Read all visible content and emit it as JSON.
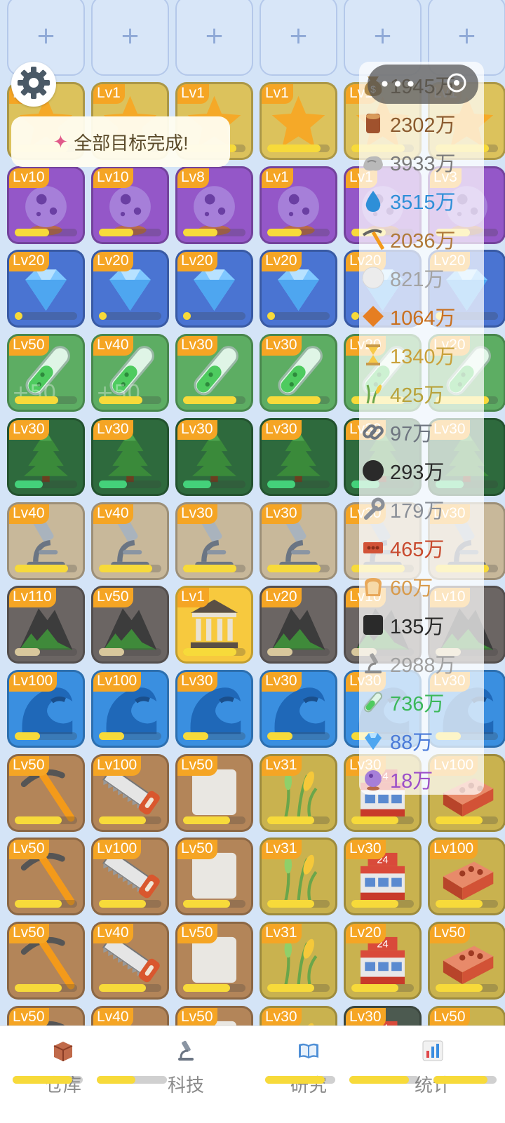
{
  "top_slots": {
    "symbol": "+",
    "count": 6
  },
  "settings": {
    "icon": "gear-icon"
  },
  "toast": {
    "icon": "party-popper-icon",
    "text": "全部目标完成!"
  },
  "capsule": {
    "menu_icon": "more-dots-icon",
    "close_icon": "close-circle-icon"
  },
  "colors": {
    "yellow": "#dcc25c",
    "purple": "#9457c8",
    "blue": "#4a74d2",
    "green": "#5dad63",
    "darkgreen": "#2e6a3d",
    "beige": "#c8b89a",
    "gray": "#6b6563",
    "sea": "#3a8fe0",
    "brown": "#b38559",
    "olive": "#c9b24f",
    "gold": "#f7c93e",
    "slate": "#4c5a50",
    "level_badge": "#f5a524",
    "progress": "#f7da3a"
  },
  "grid": {
    "rows": [
      [
        {
          "lv": "Lv1",
          "icon": "star-icon",
          "color": "yellow",
          "progress": 0.85
        },
        {
          "lv": "Lv1",
          "icon": "star-icon",
          "color": "yellow",
          "progress": 0.85
        },
        {
          "lv": "Lv1",
          "icon": "star-icon",
          "color": "yellow",
          "progress": 0.85
        },
        {
          "lv": "Lv1",
          "icon": "star-icon",
          "color": "yellow",
          "progress": 0.85
        },
        {
          "lv": "Lv1",
          "icon": "star-icon",
          "color": "yellow",
          "progress": 0.85
        },
        {
          "lv": "Lv1",
          "icon": "star-icon",
          "color": "yellow",
          "progress": 0.85
        }
      ],
      [
        {
          "lv": "Lv10",
          "icon": "crystal-ball-icon",
          "color": "purple",
          "progress": 0.55
        },
        {
          "lv": "Lv10",
          "icon": "crystal-ball-icon",
          "color": "purple",
          "progress": 0.55
        },
        {
          "lv": "Lv8",
          "icon": "crystal-ball-icon",
          "color": "purple",
          "progress": 0.55
        },
        {
          "lv": "Lv1",
          "icon": "crystal-ball-icon",
          "color": "purple",
          "progress": 0.55
        },
        {
          "lv": "Lv1",
          "icon": "crystal-ball-icon",
          "color": "purple",
          "progress": 0.55
        },
        {
          "lv": "Lv3",
          "icon": "crystal-ball-icon",
          "color": "purple",
          "progress": 0.55
        }
      ],
      [
        {
          "lv": "Lv20",
          "icon": "diamond-icon",
          "color": "blue",
          "progress": 0.05
        },
        {
          "lv": "Lv20",
          "icon": "diamond-icon",
          "color": "blue",
          "progress": 0.05
        },
        {
          "lv": "Lv20",
          "icon": "diamond-icon",
          "color": "blue",
          "progress": 0.05
        },
        {
          "lv": "Lv20",
          "icon": "diamond-icon",
          "color": "blue",
          "progress": 0.05
        },
        {
          "lv": "Lv20",
          "icon": "diamond-icon",
          "color": "blue",
          "progress": 0.05
        },
        {
          "lv": "Lv20",
          "icon": "diamond-icon",
          "color": "blue",
          "progress": 0.05
        }
      ],
      [
        {
          "lv": "Lv50",
          "icon": "test-tube-icon",
          "color": "green",
          "progress": 0.7,
          "ghost": "+50"
        },
        {
          "lv": "Lv40",
          "icon": "test-tube-icon",
          "color": "green",
          "progress": 0.7,
          "ghost": "+50"
        },
        {
          "lv": "Lv30",
          "icon": "test-tube-icon",
          "color": "green",
          "progress": 0.85
        },
        {
          "lv": "Lv30",
          "icon": "test-tube-icon",
          "color": "green",
          "progress": 0.85
        },
        {
          "lv": "Lv20",
          "icon": "test-tube-icon",
          "color": "green",
          "progress": 0.85
        },
        {
          "lv": "Lv20",
          "icon": "test-tube-icon",
          "color": "green",
          "progress": 0.85
        }
      ],
      [
        {
          "lv": "Lv30",
          "icon": "pine-tree-icon",
          "color": "darkgreen",
          "progress": 0.45,
          "bar": "green"
        },
        {
          "lv": "Lv30",
          "icon": "pine-tree-icon",
          "color": "darkgreen",
          "progress": 0.45,
          "bar": "green"
        },
        {
          "lv": "Lv30",
          "icon": "pine-tree-icon",
          "color": "darkgreen",
          "progress": 0.45,
          "bar": "green"
        },
        {
          "lv": "Lv30",
          "icon": "pine-tree-icon",
          "color": "darkgreen",
          "progress": 0.45,
          "bar": "green"
        },
        {
          "lv": "Lv30",
          "icon": "pine-tree-icon",
          "color": "darkgreen",
          "progress": 0.45,
          "bar": "green"
        },
        {
          "lv": "Lv30",
          "icon": "pine-tree-icon",
          "color": "darkgreen",
          "progress": 0.45,
          "bar": "green"
        }
      ],
      [
        {
          "lv": "Lv40",
          "icon": "microscope-icon",
          "color": "beige",
          "progress": 0.85
        },
        {
          "lv": "Lv40",
          "icon": "microscope-icon",
          "color": "beige",
          "progress": 0.85
        },
        {
          "lv": "Lv30",
          "icon": "microscope-icon",
          "color": "beige",
          "progress": 0.85
        },
        {
          "lv": "Lv30",
          "icon": "microscope-icon",
          "color": "beige",
          "progress": 0.85
        },
        {
          "lv": "Lv30",
          "icon": "microscope-icon",
          "color": "beige",
          "progress": 0.85
        },
        {
          "lv": "Lv30",
          "icon": "microscope-icon",
          "color": "beige",
          "progress": 0.85
        }
      ],
      [
        {
          "lv": "Lv110",
          "icon": "mountain-icon",
          "color": "gray",
          "progress": 0.4,
          "bar": "tan"
        },
        {
          "lv": "Lv50",
          "icon": "mountain-icon",
          "color": "gray",
          "progress": 0.4,
          "bar": "tan"
        },
        {
          "lv": "Lv1",
          "icon": "bank-icon",
          "color": "gold",
          "progress": 0.85
        },
        {
          "lv": "Lv20",
          "icon": "mountain-icon",
          "color": "gray",
          "progress": 0.4,
          "bar": "tan"
        },
        {
          "lv": "Lv10",
          "icon": "mountain-icon",
          "color": "gray",
          "progress": 0.4,
          "bar": "tan"
        },
        {
          "lv": "Lv10",
          "icon": "mountain-icon",
          "color": "gray",
          "progress": 0.4,
          "bar": "tan"
        }
      ],
      [
        {
          "lv": "Lv100",
          "icon": "wave-icon",
          "color": "sea",
          "progress": 0.4
        },
        {
          "lv": "Lv100",
          "icon": "wave-icon",
          "color": "sea",
          "progress": 0.4
        },
        {
          "lv": "Lv30",
          "icon": "wave-icon",
          "color": "sea",
          "progress": 0.4
        },
        {
          "lv": "Lv30",
          "icon": "wave-icon",
          "color": "sea",
          "progress": 0.4
        },
        {
          "lv": "Lv30",
          "icon": "wave-icon",
          "color": "sea",
          "progress": 0.4
        },
        {
          "lv": "Lv30",
          "icon": "wave-icon",
          "color": "sea",
          "progress": 0.4
        }
      ],
      [
        {
          "lv": "Lv50",
          "icon": "pickaxe-icon",
          "color": "brown",
          "progress": 0.75
        },
        {
          "lv": "Lv100",
          "icon": "saw-icon",
          "color": "brown",
          "progress": 0.75
        },
        {
          "lv": "Lv50",
          "icon": "blank-tile-icon",
          "color": "brown",
          "progress": 0.75
        },
        {
          "lv": "Lv31",
          "icon": "grain-icon",
          "color": "olive",
          "progress": 0.75
        },
        {
          "lv": "Lv30",
          "icon": "store-icon",
          "color": "olive",
          "progress": 0.75
        },
        {
          "lv": "Lv100",
          "icon": "brick-icon",
          "color": "olive",
          "progress": 0.75
        }
      ],
      [
        {
          "lv": "Lv50",
          "icon": "pickaxe-icon",
          "color": "brown",
          "progress": 0.75
        },
        {
          "lv": "Lv100",
          "icon": "saw-icon",
          "color": "brown",
          "progress": 0.75
        },
        {
          "lv": "Lv50",
          "icon": "blank-tile-icon",
          "color": "brown",
          "progress": 0.75
        },
        {
          "lv": "Lv31",
          "icon": "grain-icon",
          "color": "olive",
          "progress": 0.75
        },
        {
          "lv": "Lv30",
          "icon": "store-icon",
          "color": "olive",
          "progress": 0.75
        },
        {
          "lv": "Lv100",
          "icon": "brick-icon",
          "color": "olive",
          "progress": 0.75
        }
      ],
      [
        {
          "lv": "Lv50",
          "icon": "pickaxe-icon",
          "color": "brown",
          "progress": 0.75
        },
        {
          "lv": "Lv40",
          "icon": "saw-icon",
          "color": "brown",
          "progress": 0.75
        },
        {
          "lv": "Lv50",
          "icon": "blank-tile-icon",
          "color": "brown",
          "progress": 0.75
        },
        {
          "lv": "Lv31",
          "icon": "grain-icon",
          "color": "olive",
          "progress": 0.75
        },
        {
          "lv": "Lv20",
          "icon": "store-icon",
          "color": "olive",
          "progress": 0.75
        },
        {
          "lv": "Lv50",
          "icon": "brick-icon",
          "color": "olive",
          "progress": 0.75
        }
      ],
      [
        {
          "lv": "Lv50",
          "icon": "pickaxe-icon",
          "color": "brown",
          "progress": 0.75
        },
        {
          "lv": "Lv40",
          "icon": "saw-icon",
          "color": "brown",
          "progress": 0.75
        },
        {
          "lv": "Lv50",
          "icon": "blank-tile-icon",
          "color": "brown",
          "progress": 0.75
        },
        {
          "lv": "Lv30",
          "icon": "grain-icon",
          "color": "olive",
          "progress": 0.75
        },
        {
          "lv": "Lv30",
          "icon": "store-icon",
          "color": "slate",
          "progress": 0.75
        },
        {
          "lv": "Lv50",
          "icon": "brick-icon",
          "color": "olive",
          "progress": 0.75
        }
      ]
    ]
  },
  "resources": [
    {
      "icon": "money-bag-icon",
      "value": "1945万",
      "color": "#7a6a4a"
    },
    {
      "icon": "wood-log-icon",
      "value": "2302万",
      "color": "#8a5a2e"
    },
    {
      "icon": "stone-icon",
      "value": "3933万",
      "color": "#7b7b7b"
    },
    {
      "icon": "water-drop-icon",
      "value": "3515万",
      "color": "#2e8fd8"
    },
    {
      "icon": "pickaxe-icon",
      "value": "2036万",
      "color": "#b07a3a"
    },
    {
      "icon": "white-circle-icon",
      "value": "821万",
      "color": "#a3a3a3"
    },
    {
      "icon": "orange-diamond-icon",
      "value": "1064万",
      "color": "#c9701f"
    },
    {
      "icon": "hourglass-icon",
      "value": "1340万",
      "color": "#c9a13a"
    },
    {
      "icon": "grain-icon",
      "value": "425万",
      "color": "#b8a23a"
    },
    {
      "icon": "chain-link-icon",
      "value": "97万",
      "color": "#6e7580"
    },
    {
      "icon": "black-circle-icon",
      "value": "293万",
      "color": "#2a2a2a"
    },
    {
      "icon": "wrench-icon",
      "value": "179万",
      "color": "#8a8f98"
    },
    {
      "icon": "brick-icon",
      "value": "465万",
      "color": "#c84a2e"
    },
    {
      "icon": "bread-icon",
      "value": "60万",
      "color": "#d89a4a"
    },
    {
      "icon": "black-square-icon",
      "value": "135万",
      "color": "#2a2a2a"
    },
    {
      "icon": "microscope-icon",
      "value": "2988万",
      "color": "#a0a0a0"
    },
    {
      "icon": "test-tube-icon",
      "value": "736万",
      "color": "#3cb85a"
    },
    {
      "icon": "diamond-icon",
      "value": "88万",
      "color": "#4a7ad8"
    },
    {
      "icon": "crystal-ball-icon",
      "value": "18万",
      "color": "#9b4fc9"
    }
  ],
  "tabs": [
    {
      "label": "仓库",
      "icon": "warehouse-box-icon",
      "progress": 0.85
    },
    {
      "label": "科技",
      "icon": "microscope-icon",
      "progress": 0.55
    },
    {
      "label": "研究",
      "icon": "book-icon",
      "progress": 0.85
    },
    {
      "label": "统计",
      "icon": "bar-chart-icon",
      "progress": 0.85
    }
  ]
}
